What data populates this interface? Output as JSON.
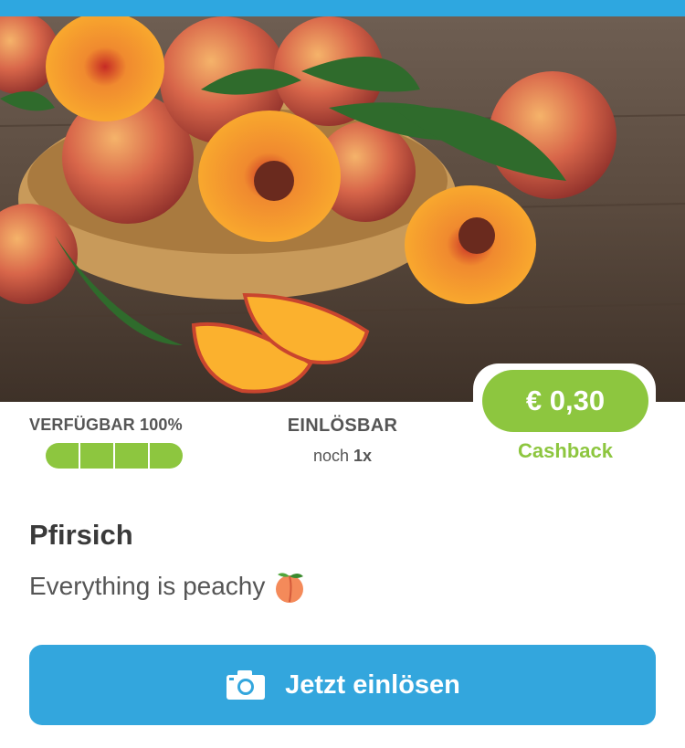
{
  "offer": {
    "image_alt": "Peaches in a basket",
    "price": "€ 0,30",
    "cashback_label": "Cashback",
    "title": "Pfirsich",
    "subtitle": "Everything is peachy",
    "subtitle_emoji": "peach-emoji"
  },
  "availability": {
    "label_prefix": "VERFÜGBAR",
    "percent": "100%",
    "segments_filled": 4,
    "segments_total": 4
  },
  "redeemable": {
    "label": "EINLÖSBAR",
    "prefix": "noch",
    "count": "1x"
  },
  "cta": {
    "label": "Jetzt einlösen",
    "icon": "camera-icon"
  },
  "colors": {
    "accent_green": "#8dc63f",
    "accent_blue": "#33a6dd",
    "top_bar": "#2ea7e0"
  }
}
